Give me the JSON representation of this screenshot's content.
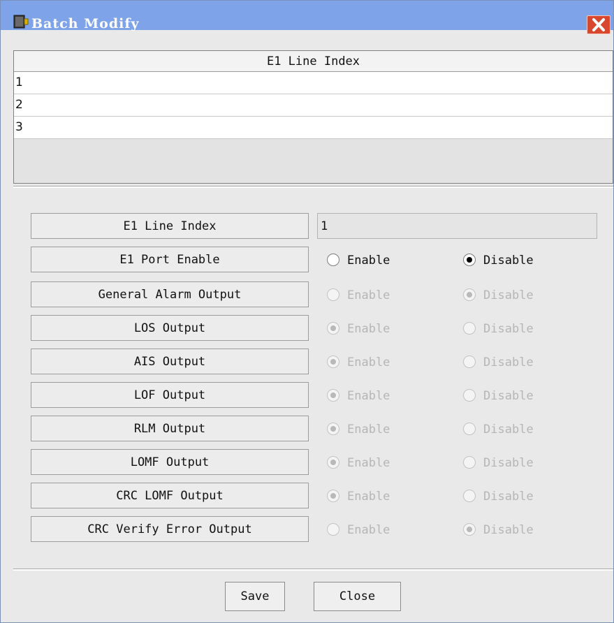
{
  "window": {
    "title": "Batch Modify",
    "app_icon": "safe-box-icon",
    "close_icon": "close-icon"
  },
  "table": {
    "header": "E1 Line Index",
    "rows": [
      "1",
      "2",
      "3"
    ]
  },
  "form": {
    "line_index": {
      "label": "E1 Line Index",
      "value": "1"
    },
    "options": [
      {
        "label": "E1 Port Enable",
        "enable_label": "Enable",
        "disable_label": "Disable",
        "selected": "Disable",
        "enabled": true
      },
      {
        "label": "General Alarm Output",
        "enable_label": "Enable",
        "disable_label": "Disable",
        "selected": "Disable",
        "enabled": false
      },
      {
        "label": "LOS Output",
        "enable_label": "Enable",
        "disable_label": "Disable",
        "selected": "Enable",
        "enabled": false
      },
      {
        "label": "AIS Output",
        "enable_label": "Enable",
        "disable_label": "Disable",
        "selected": "Enable",
        "enabled": false
      },
      {
        "label": "LOF Output",
        "enable_label": "Enable",
        "disable_label": "Disable",
        "selected": "Enable",
        "enabled": false
      },
      {
        "label": "RLM Output",
        "enable_label": "Enable",
        "disable_label": "Disable",
        "selected": "Enable",
        "enabled": false
      },
      {
        "label": "LOMF Output",
        "enable_label": "Enable",
        "disable_label": "Disable",
        "selected": "Enable",
        "enabled": false
      },
      {
        "label": "CRC LOMF Output",
        "enable_label": "Enable",
        "disable_label": "Disable",
        "selected": "Enable",
        "enabled": false
      },
      {
        "label": "CRC Verify Error Output",
        "enable_label": "Enable",
        "disable_label": "Disable",
        "selected": "Disable",
        "enabled": false
      }
    ]
  },
  "buttons": {
    "save": "Save",
    "close": "Close"
  }
}
